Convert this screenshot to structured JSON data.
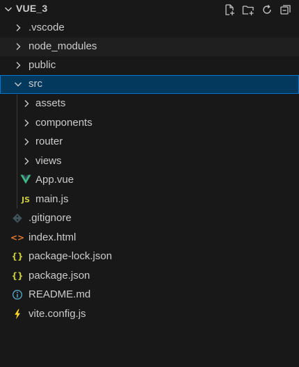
{
  "explorer": {
    "project_title": "VUE_3",
    "actions": [
      {
        "name": "new-file-icon"
      },
      {
        "name": "new-folder-icon"
      },
      {
        "name": "refresh-icon"
      },
      {
        "name": "collapse-all-icon"
      }
    ]
  },
  "tree": [
    {
      "label": ".vscode",
      "type": "folder",
      "expanded": false
    },
    {
      "label": "node_modules",
      "type": "folder",
      "expanded": false
    },
    {
      "label": "public",
      "type": "folder",
      "expanded": false
    },
    {
      "label": "src",
      "type": "folder",
      "expanded": true,
      "selected": true
    },
    {
      "label": "assets",
      "type": "folder",
      "expanded": false
    },
    {
      "label": "components",
      "type": "folder",
      "expanded": false
    },
    {
      "label": "router",
      "type": "folder",
      "expanded": false
    },
    {
      "label": "views",
      "type": "folder",
      "expanded": false
    },
    {
      "label": "App.vue",
      "type": "file",
      "icon": "vue-icon",
      "icon_color": "#41b883"
    },
    {
      "label": "main.js",
      "type": "file",
      "icon": "js-icon",
      "icon_text": "JS",
      "icon_color": "#cbcb41"
    },
    {
      "label": ".gitignore",
      "type": "file",
      "icon": "git-icon",
      "icon_color": "#41535b"
    },
    {
      "label": "index.html",
      "type": "file",
      "icon": "html-icon",
      "icon_text": "<>",
      "icon_color": "#e37933"
    },
    {
      "label": "package-lock.json",
      "type": "file",
      "icon": "json-icon",
      "icon_text": "{}",
      "icon_color": "#cbcb41"
    },
    {
      "label": "package.json",
      "type": "file",
      "icon": "json-icon",
      "icon_text": "{}",
      "icon_color": "#cbcb41"
    },
    {
      "label": "README.md",
      "type": "file",
      "icon": "info-icon",
      "icon_color": "#519aba"
    },
    {
      "label": "vite.config.js",
      "type": "file",
      "icon": "vite-icon",
      "icon_color": "#ffd62e"
    }
  ],
  "colors": {
    "background": "#181818",
    "selected_background": "#04395e",
    "focus_border": "#0078d4",
    "text": "#cccccc"
  }
}
